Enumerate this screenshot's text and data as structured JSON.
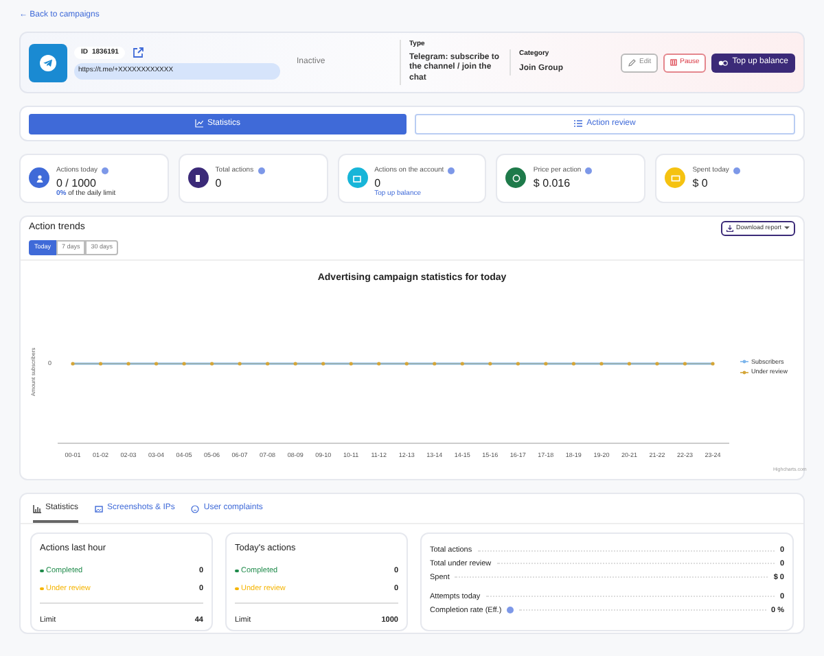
{
  "back_link": "← Back to campaigns",
  "campaign": {
    "id_label": "ID",
    "id": "1836191",
    "url": "https://t.me/+XXXXXXXXXXXX",
    "status": "Inactive",
    "type_label": "Type",
    "type": "Telegram: subscribe to the channel / join the chat",
    "category_label": "Category",
    "category": "Join Group"
  },
  "actions": [
    {
      "label": "Edit",
      "kind": "edit"
    },
    {
      "label": "Pause",
      "kind": "pause"
    },
    {
      "label": "Top up balance",
      "kind": "topup"
    }
  ],
  "view_tabs": [
    {
      "label": "Statistics",
      "selected": true
    },
    {
      "label": "Action review",
      "selected": false
    }
  ],
  "stats": [
    {
      "label": "Actions today",
      "value": "0 / 1000",
      "note_bold": "0%",
      "note": "of the daily limit",
      "color": "#3f6ad8"
    },
    {
      "label": "Total actions",
      "value": "0",
      "color": "#3b2a78"
    },
    {
      "label": "Actions on the account",
      "value": "0",
      "link": "Top up balance",
      "color": "#17b5d8"
    },
    {
      "label": "Price per action",
      "value": "$ 0.016",
      "color": "#1e7a4a"
    },
    {
      "label": "Spent today",
      "value": "$ 0",
      "color": "#f5c211"
    }
  ],
  "trends": {
    "title": "Action trends",
    "download": "Download report",
    "ranges": [
      {
        "label": "Today",
        "selected": true
      },
      {
        "label": "7 days",
        "selected": false
      },
      {
        "label": "30 days",
        "selected": false
      }
    ],
    "chart": {
      "title": "Advertising campaign statistics for today",
      "ylabel": "Amount subscribers",
      "y_tick": "0",
      "categories": [
        "00-01",
        "01-02",
        "02-03",
        "03-04",
        "04-05",
        "05-06",
        "06-07",
        "07-08",
        "08-09",
        "09-10",
        "10-11",
        "11-12",
        "12-13",
        "13-14",
        "14-15",
        "15-16",
        "16-17",
        "17-18",
        "18-19",
        "19-20",
        "20-21",
        "21-22",
        "22-23",
        "23-24"
      ],
      "legend": [
        {
          "name": "Subscribers",
          "color": "#7cb5ec"
        },
        {
          "name": "Under review",
          "color": "#d4a537"
        }
      ]
    },
    "credits": "Highcharts.com"
  },
  "bottom_tabs": [
    {
      "label": "Statistics",
      "selected": true
    },
    {
      "label": "Screenshots & IPs",
      "selected": false
    },
    {
      "label": "User complaints",
      "selected": false
    }
  ],
  "panels": [
    {
      "title": "Actions last hour",
      "rows": [
        {
          "label": "Completed",
          "value": "0",
          "color": "#1e8a4a"
        },
        {
          "label": "Under review",
          "value": "0",
          "color": "#f5b400"
        }
      ],
      "limit_label": "Limit",
      "limit": "44"
    },
    {
      "title": "Today's actions",
      "rows": [
        {
          "label": "Completed",
          "value": "0",
          "color": "#1e8a4a"
        },
        {
          "label": "Under review",
          "value": "0",
          "color": "#f5b400"
        }
      ],
      "limit_label": "Limit",
      "limit": "1000"
    }
  ],
  "summary": [
    [
      {
        "label": "Total actions",
        "value": "0"
      },
      {
        "label": "Total under review",
        "value": "0"
      },
      {
        "label": "Spent",
        "value": "$ 0"
      }
    ],
    [
      {
        "label": "Attempts today",
        "value": "0"
      },
      {
        "label": "Completion rate (Eff.)",
        "value": "0 %",
        "help": true
      }
    ]
  ]
}
